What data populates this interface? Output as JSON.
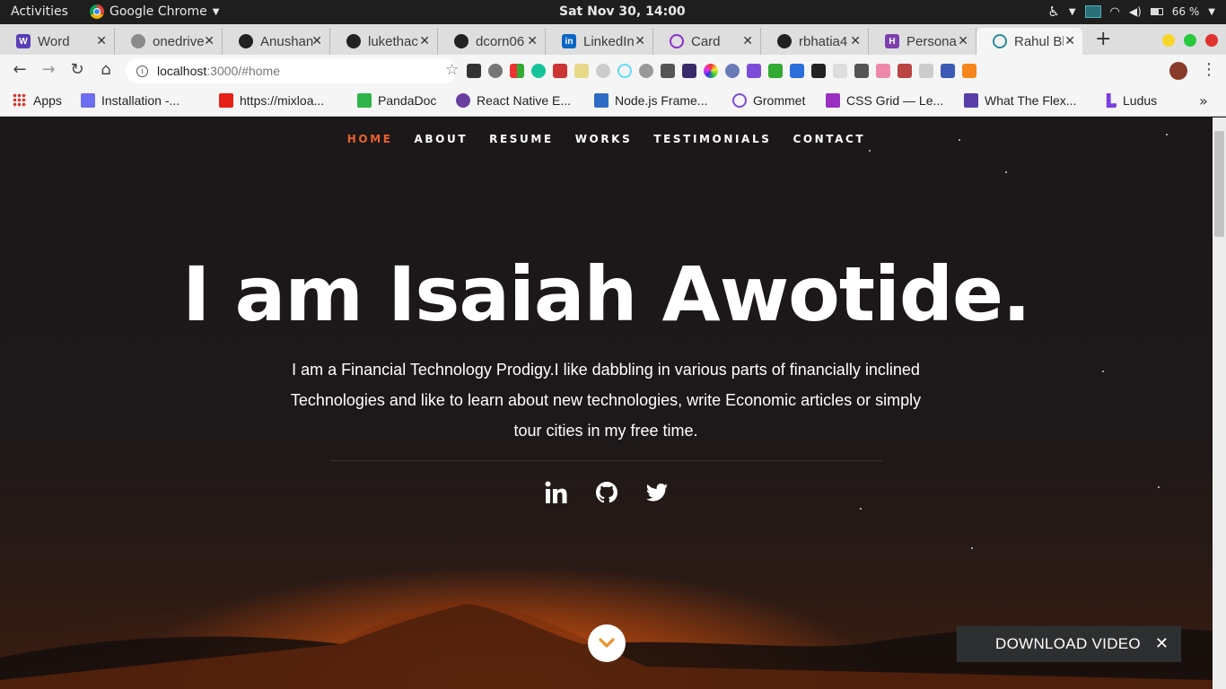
{
  "system_bar": {
    "activities": "Activities",
    "app_name": "Google Chrome",
    "clock": "Sat Nov 30, 14:00",
    "battery": "66 %"
  },
  "tabs": [
    {
      "label": "Word",
      "icon": "word-icon",
      "color": "#5b3fb5"
    },
    {
      "label": "onedrive",
      "icon": "globe-icon",
      "color": "#8a8a8a"
    },
    {
      "label": "Anushan",
      "icon": "github-icon",
      "color": "#222222"
    },
    {
      "label": "lukethac",
      "icon": "github-icon",
      "color": "#222222"
    },
    {
      "label": "dcorn06",
      "icon": "github-icon",
      "color": "#222222"
    },
    {
      "label": "LinkedIn",
      "icon": "linkedin-icon",
      "color": "#0a66c2"
    },
    {
      "label": "Card",
      "icon": "circle-icon",
      "color": "#8b2fc9"
    },
    {
      "label": "rbhatia4",
      "icon": "github-icon",
      "color": "#222222"
    },
    {
      "label": "Persona",
      "icon": "heroku-icon",
      "color": "#7d3fae"
    },
    {
      "label": "Rahul Bh",
      "icon": "react-icon",
      "color": "#2b8a9c"
    }
  ],
  "address_bar": {
    "host": "localhost",
    "path": ":3000/#home"
  },
  "bookmarks": [
    {
      "label": "Apps",
      "icon": "apps-grid-icon",
      "color": "#d93025"
    },
    {
      "label": "Installation -...",
      "icon": "bookmark-icon",
      "color": "#6d6df2"
    },
    {
      "label": "https://mixloa...",
      "icon": "youtube-icon",
      "color": "#e62117"
    },
    {
      "label": "PandaDoc",
      "icon": "pandadoc-icon",
      "color": "#2fb44a"
    },
    {
      "label": "React Native E...",
      "icon": "react-native-icon",
      "color": "#6a3ea1"
    },
    {
      "label": "Node.js Frame...",
      "icon": "node-icon",
      "color": "#2d6bc4"
    },
    {
      "label": "Grommet",
      "icon": "grommet-icon",
      "color": "#7d4cdb"
    },
    {
      "label": "CSS Grid — Le...",
      "icon": "css-grid-icon",
      "color": "#9b2fc2"
    },
    {
      "label": "What The Flex...",
      "icon": "flex-icon",
      "color": "#5a3fa8"
    },
    {
      "label": "Ludus",
      "icon": "ludus-icon",
      "color": "#7b3fe0"
    }
  ],
  "site": {
    "nav": [
      {
        "label": "HOME",
        "current": true
      },
      {
        "label": "ABOUT",
        "current": false
      },
      {
        "label": "RESUME",
        "current": false
      },
      {
        "label": "WORKS",
        "current": false
      },
      {
        "label": "TESTIMONIALS",
        "current": false
      },
      {
        "label": "CONTACT",
        "current": false
      }
    ],
    "accent_color": "#e8612c",
    "title": "I am Isaiah Awotide.",
    "bio": "I am a Financial Technology Prodigy.I like dabbling in various parts of financially inclined Technologies and like to learn about new technologies, write Economic articles or simply tour cities in my free time.",
    "social": [
      "linkedin-icon",
      "github-icon",
      "twitter-icon"
    ]
  },
  "download_bar": {
    "label": "DOWNLOAD VIDEO",
    "close": "✕"
  }
}
